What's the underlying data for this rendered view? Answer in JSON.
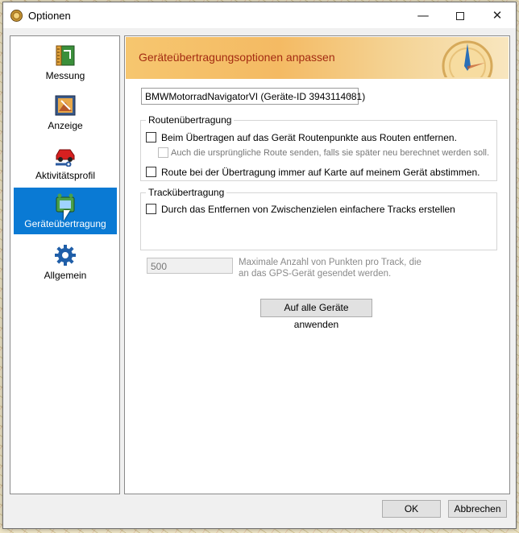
{
  "window": {
    "title": "Optionen",
    "controls": {
      "minimize": "—",
      "close": "✕"
    }
  },
  "sidebar": {
    "items": [
      {
        "label": "Messung",
        "icon": "ruler-map-icon",
        "selected": false
      },
      {
        "label": "Anzeige",
        "icon": "display-picture-icon",
        "selected": false
      },
      {
        "label": "Aktivitätsprofil",
        "icon": "car-wrench-icon",
        "selected": false
      },
      {
        "label": "Geräteübertragung",
        "icon": "device-transfer-icon",
        "selected": true
      },
      {
        "label": "Allgemein",
        "icon": "gear-icon",
        "selected": false
      }
    ]
  },
  "content": {
    "header_title": "Geräteübertragungsoptionen anpassen",
    "device_dropdown": {
      "value": "BMWMotorradNavigatorVI (Geräte-ID 3943114081)"
    },
    "route_group": {
      "legend": "Routenübertragung",
      "remove_shaping_points": {
        "label": "Beim Übertragen auf das Gerät Routenpunkte aus Routen entfernen.",
        "checked": false
      },
      "send_original_route": {
        "label": "Auch die ursprüngliche Route senden, falls sie später neu berechnet werden soll.",
        "checked": false,
        "disabled": true
      },
      "match_map": {
        "label": "Route bei der Übertragung immer auf Karte auf meinem Gerät abstimmen.",
        "checked": false
      }
    },
    "track_group": {
      "legend": "Trackübertragung",
      "simplify_tracks": {
        "label": "Durch das Entfernen von Zwischenzielen einfachere Tracks erstellen",
        "checked": false
      },
      "max_points": {
        "value": "500",
        "help": "Maximale Anzahl von Punkten pro Track, die an das GPS-Gerät gesendet werden."
      }
    },
    "apply_all_button": "Auf alle Geräte anwenden"
  },
  "footer": {
    "ok_button": "OK",
    "cancel_button": "Abbrechen"
  },
  "colors": {
    "selection": "#0a7ad4",
    "header_title": "#a32b12",
    "header_band": "#f4ba63"
  }
}
